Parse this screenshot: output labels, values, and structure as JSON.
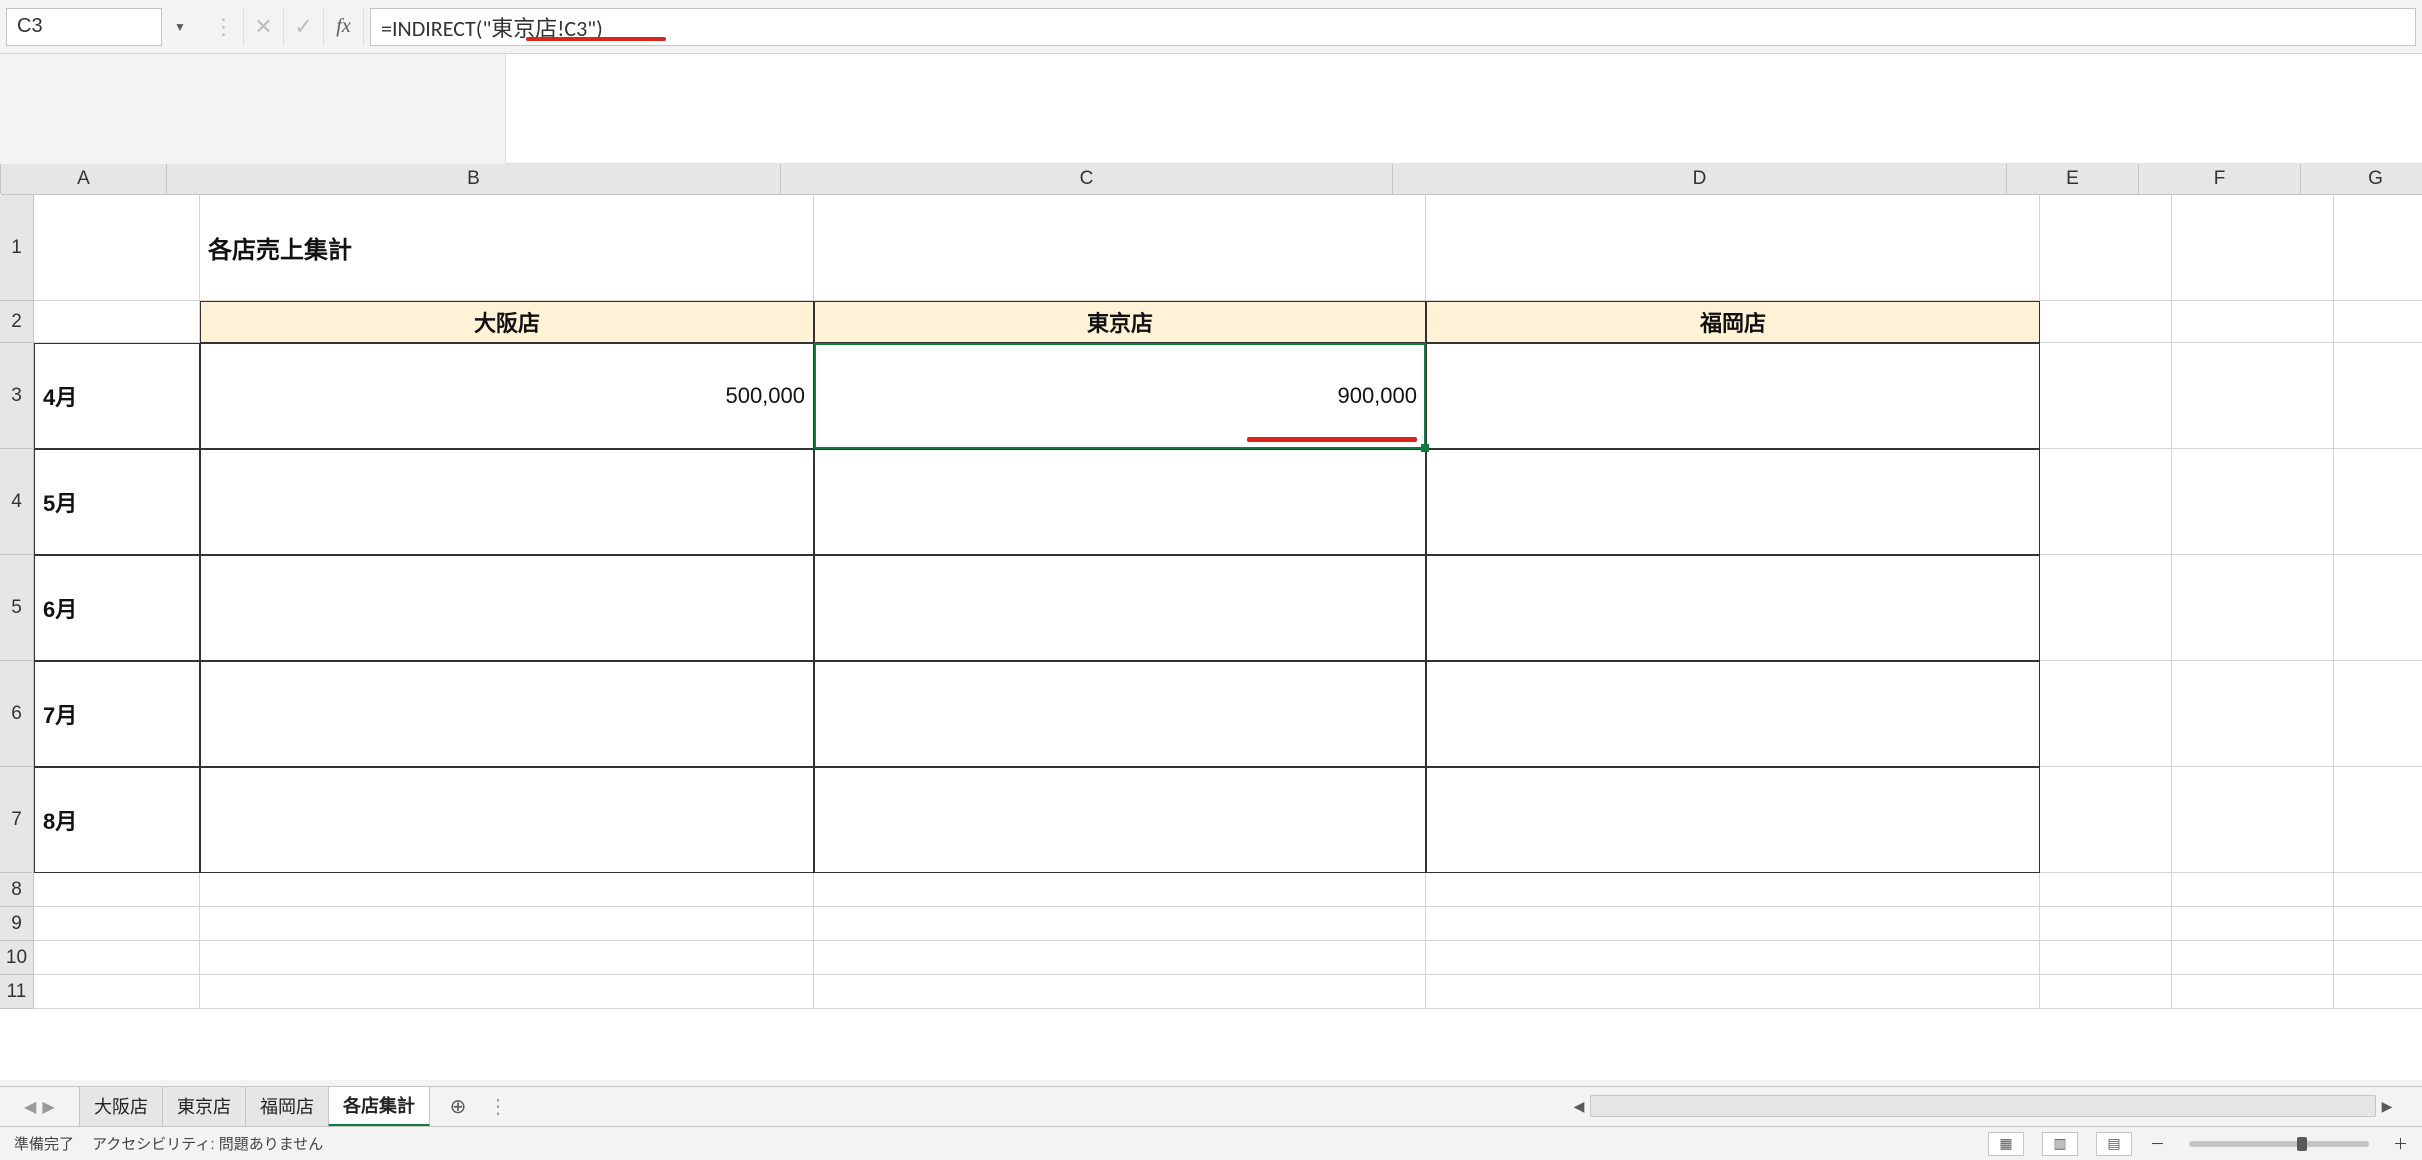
{
  "name_box": "C3",
  "formula_text": "=INDIRECT(\"東京店!C3\")",
  "title_cell": "各店売上集計",
  "col_labels": [
    "A",
    "B",
    "C",
    "D",
    "E",
    "F",
    "G"
  ],
  "row_labels": [
    "1",
    "2",
    "3",
    "4",
    "5",
    "6",
    "7",
    "8",
    "9",
    "10",
    "11"
  ],
  "table": {
    "headers": [
      "大阪店",
      "東京店",
      "福岡店"
    ],
    "rows": [
      {
        "label": "4月",
        "values": [
          "500,000",
          "900,000",
          ""
        ]
      },
      {
        "label": "5月",
        "values": [
          "",
          "",
          ""
        ]
      },
      {
        "label": "6月",
        "values": [
          "",
          "",
          ""
        ]
      },
      {
        "label": "7月",
        "values": [
          "",
          "",
          ""
        ]
      },
      {
        "label": "8月",
        "values": [
          "",
          "",
          ""
        ]
      }
    ]
  },
  "tabs": [
    "大阪店",
    "東京店",
    "福岡店",
    "各店集計"
  ],
  "active_tab_index": 3,
  "status": {
    "ready": "準備完了",
    "accessibility": "アクセシビリティ: 問題ありません"
  },
  "icons": {
    "dropdown": "▼",
    "cancel": "✕",
    "enter": "✓",
    "fx": "fx",
    "nav_prev": "◀",
    "nav_next": "▶",
    "add": "⊕",
    "more": "⋮",
    "left": "◀",
    "right": "▶"
  }
}
